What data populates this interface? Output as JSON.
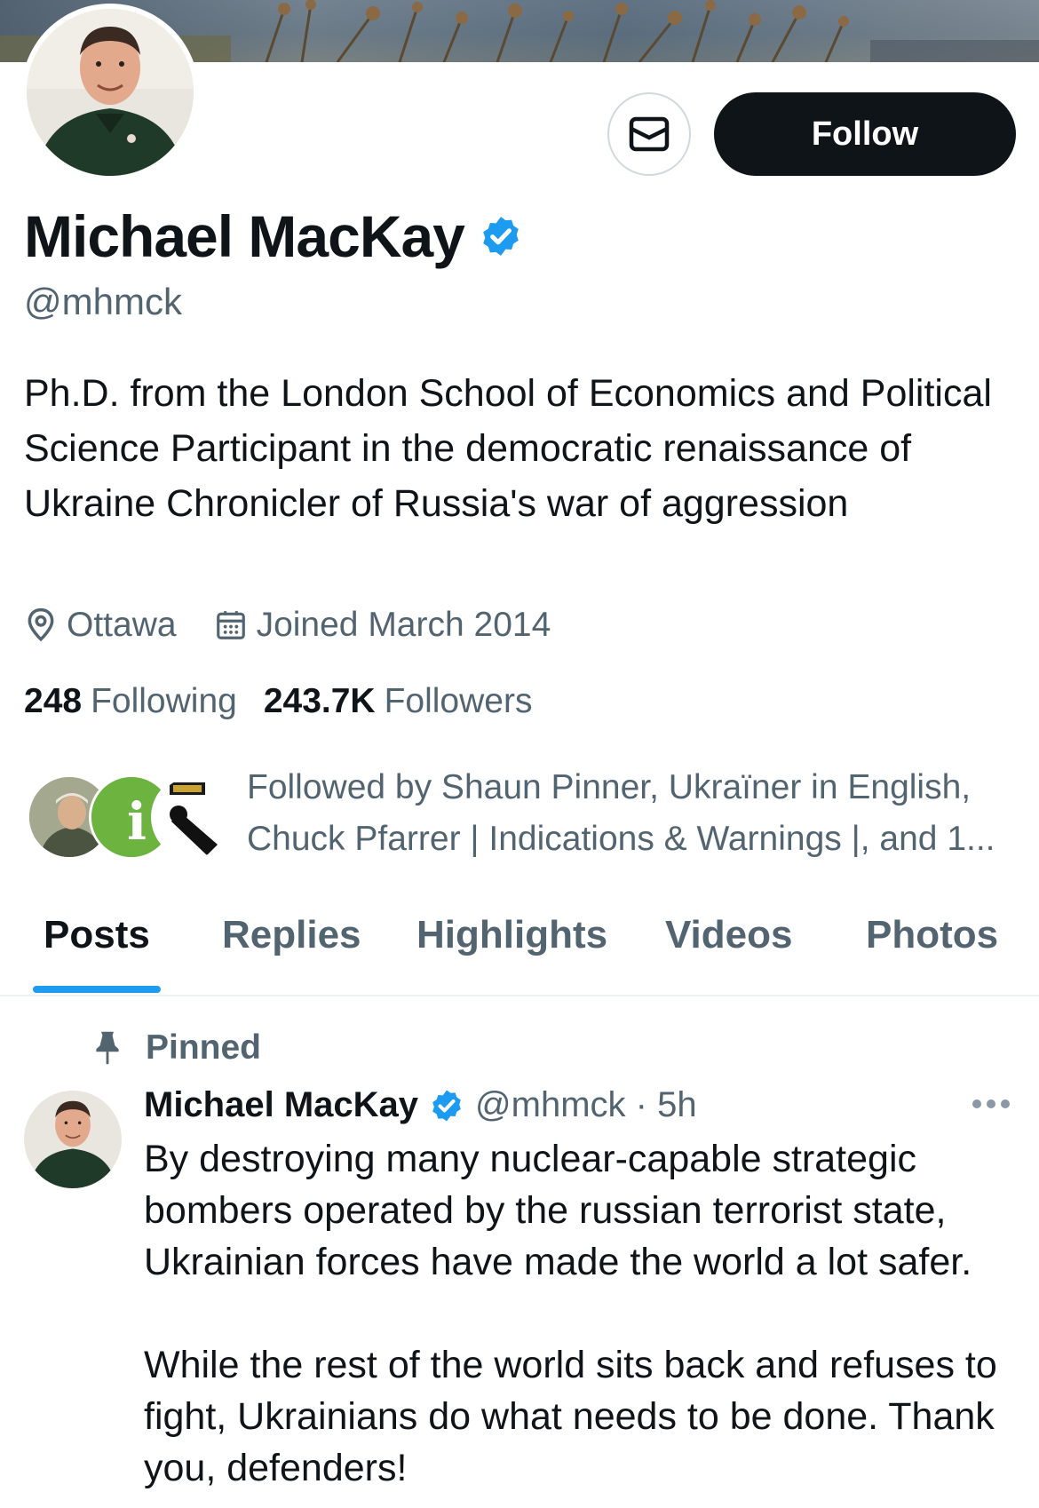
{
  "banner": {
    "description_icon": "banner-image"
  },
  "profile": {
    "name": "Michael MacKay",
    "handle": "@mhmck",
    "bio": "Ph.D. from the London School of Economics and Political Science Participant in the democratic renaissance of Ukraine Chronicler of Russia's war of aggression",
    "location": "Ottawa",
    "joined": "Joined March 2014",
    "following_count": "248",
    "following_label": "Following",
    "followers_count": "243.7K",
    "followers_label": "Followers",
    "followed_by": "Followed by Shaun Pinner, Ukraïner in English, Chuck Pfarrer | Indications & Warnings |, and 1..."
  },
  "actions": {
    "message_icon": "mail-icon",
    "follow_label": "Follow"
  },
  "tabs": [
    {
      "label": "Posts",
      "active": true
    },
    {
      "label": "Replies",
      "active": false
    },
    {
      "label": "Highlights",
      "active": false
    },
    {
      "label": "Videos",
      "active": false
    },
    {
      "label": "Photos",
      "active": false
    }
  ],
  "post": {
    "pinned_label": "Pinned",
    "author_name": "Michael MacKay",
    "author_handle_time": "@mhmck · 5h",
    "paragraph1": "By destroying many nuclear-capable strategic bombers operated by the russian terrorist state, Ukrainian forces have made the world a lot safer.",
    "paragraph2": "While the rest of the world sits back and refuses to fight, Ukrainians do what needs to be done. Thank you, defenders!"
  },
  "colors": {
    "accent": "#1d9bf0",
    "text_primary": "#0f1419",
    "text_secondary": "#536471",
    "button_dark": "#0f1419"
  }
}
